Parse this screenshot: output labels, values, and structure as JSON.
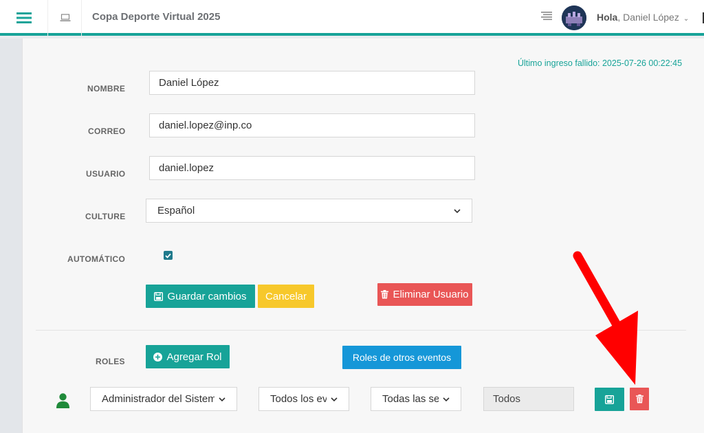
{
  "header": {
    "app_title": "Copa Deporte Virtual 2025",
    "greeting_prefix": "Hola",
    "greeting_name": ", Daniel López"
  },
  "last_login": "Último ingreso fallido: 2025-07-26 00:22:45",
  "form": {
    "nombre": {
      "label": "NOMBRE",
      "value": "Daniel López"
    },
    "correo": {
      "label": "CORREO",
      "value": "daniel.lopez@inp.co"
    },
    "usuario": {
      "label": "USUARIO",
      "value": "daniel.lopez"
    },
    "culture": {
      "label": "CULTURE",
      "value": "Español"
    },
    "automatico": {
      "label": "AUTOMÁTICO",
      "checked": true
    }
  },
  "actions": {
    "save": "Guardar cambios",
    "cancel": "Cancelar",
    "delete_user": "Eliminar Usuario"
  },
  "roles": {
    "label": "ROLES",
    "add_role": "Agregar Rol",
    "other_events": "Roles de otros eventos",
    "row": {
      "role": "Administrador del Sistema",
      "events": "Todos los eventos",
      "sections": "Todas las secciones",
      "scope": "Todos"
    }
  },
  "colors": {
    "teal": "#17a398",
    "yellow": "#f7c82b",
    "red": "#e95656",
    "blue": "#1597d8",
    "green_user": "#1f8a3a",
    "arrow": "#ff0000"
  }
}
